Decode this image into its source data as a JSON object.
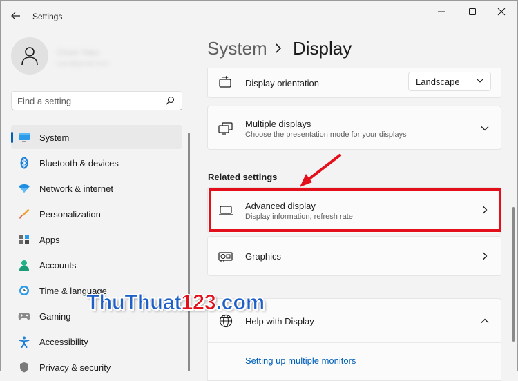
{
  "window": {
    "title": "Settings",
    "controls": {
      "minimize": "minimize-icon",
      "maximize": "maximize-icon",
      "close": "close-icon"
    }
  },
  "user": {
    "name": "Chom Yako",
    "email": "user@gmail.com"
  },
  "search": {
    "placeholder": "Find a setting"
  },
  "sidebar": {
    "items": [
      {
        "label": "System",
        "icon": "monitor-icon",
        "active": true
      },
      {
        "label": "Bluetooth & devices",
        "icon": "bluetooth-icon"
      },
      {
        "label": "Network & internet",
        "icon": "wifi-icon"
      },
      {
        "label": "Personalization",
        "icon": "brush-icon"
      },
      {
        "label": "Apps",
        "icon": "apps-icon"
      },
      {
        "label": "Accounts",
        "icon": "person-icon"
      },
      {
        "label": "Time & language",
        "icon": "clock-globe-icon"
      },
      {
        "label": "Gaming",
        "icon": "gamepad-icon"
      },
      {
        "label": "Accessibility",
        "icon": "accessibility-icon"
      },
      {
        "label": "Privacy & security",
        "icon": "shield-icon"
      }
    ]
  },
  "breadcrumb": {
    "parent": "System",
    "separator": "›",
    "current": "Display"
  },
  "display_orientation": {
    "title": "Display orientation",
    "value": "Landscape"
  },
  "multiple_displays": {
    "title": "Multiple displays",
    "subtitle": "Choose the presentation mode for your displays"
  },
  "related": {
    "heading": "Related settings",
    "advanced_display": {
      "title": "Advanced display",
      "subtitle": "Display information, refresh rate"
    },
    "graphics": {
      "title": "Graphics"
    }
  },
  "help": {
    "title": "Help with Display",
    "link": "Setting up multiple monitors"
  },
  "watermark": {
    "part1": "ThuThuat",
    "part2": "123",
    "part3": ".com"
  },
  "colors": {
    "accent": "#005fb8",
    "annotation": "#e3101b",
    "watermark_blue": "#1f5fc8"
  }
}
